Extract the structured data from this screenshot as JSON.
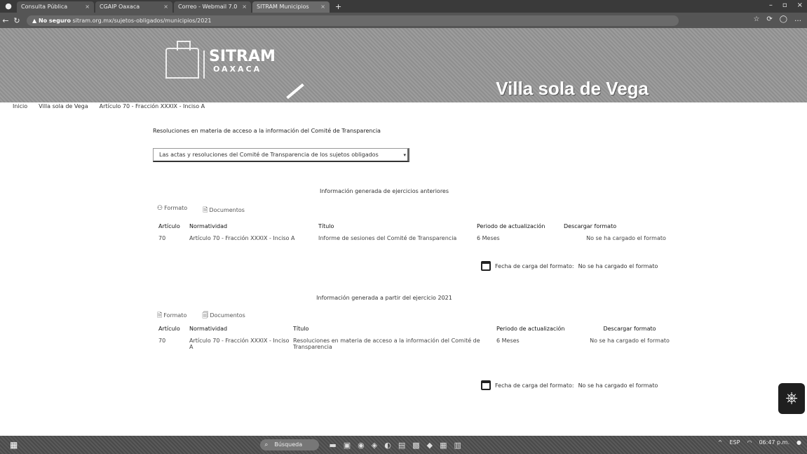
{
  "browser": {
    "tabs": [
      {
        "label": "Consulta Pública",
        "active": false
      },
      {
        "label": "CGAIP Oaxaca",
        "active": false
      },
      {
        "label": "Correo - Webmail 7.0",
        "active": false
      },
      {
        "label": "SITRAM Municipios",
        "active": true
      }
    ],
    "new_tab": "+",
    "url_warning": "No seguro",
    "url": "sitram.org.mx/sujetos-obligados/municipios/2021"
  },
  "banner": {
    "logo_main": "SITRAM",
    "logo_sub": "OAXACA",
    "place": "Villa sola de Vega"
  },
  "breadcrumb": [
    "Inicio",
    "Villa sola de Vega",
    "Artículo 70 - Fracción XXXIX - Inciso A"
  ],
  "main": {
    "section_title": "Resoluciones en materia de acceso a la información del Comité de Transparencia",
    "select_value": "Las actas y resoluciones del Comité de Transparencia de los sujetos obligados",
    "previous": {
      "title": "Información generada de ejercicios anteriores",
      "toolbar": {
        "format": "Formato",
        "documents": "Documentos"
      },
      "headers": [
        "Artículo",
        "Normatividad",
        "Título",
        "Periodo de actualización",
        "Descargar formato"
      ],
      "rows": [
        [
          "70",
          "Artículo 70 - Fracción XXXIX - Inciso A",
          "Informe de sesiones del Comité de Transparencia",
          "6 Meses",
          "No se ha cargado el formato"
        ]
      ],
      "date_label": "Fecha de carga del formato:",
      "date_value": "No se ha cargado el formato"
    },
    "current": {
      "title": "Información generada a partir del ejercicio 2021",
      "toolbar": {
        "format": "Formato",
        "documents": "Documentos"
      },
      "headers": [
        "Artículo",
        "Normatividad",
        "Título",
        "Periodo de actualización",
        "Descargar formato"
      ],
      "rows": [
        [
          "70",
          "Artículo 70 - Fracción XXXIX - Inciso A",
          "Resoluciones en materia de acceso a la información del Comité de Transparencia",
          "6 Meses",
          "No se ha cargado el formato"
        ]
      ],
      "date_label": "Fecha de carga del formato:",
      "date_value": "No se ha cargado el formato"
    }
  },
  "taskbar": {
    "search_placeholder": "Búsqueda",
    "tray_lang": "ESP",
    "tray_time": "06:47 p.m."
  }
}
